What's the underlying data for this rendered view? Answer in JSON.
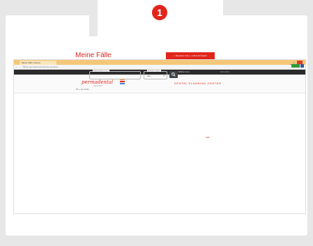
{
  "step_badge": "1",
  "browser": {
    "tab_title": "Meine Fälle | Perma",
    "address": "smile.permadental-planning.de/cases"
  },
  "app_bar": {
    "user": "Willkommen,",
    "logout": "Abmelden"
  },
  "header": {
    "logo": "permadental",
    "logo_sub": "Zahnersatz",
    "center_title": "DENTAL PLANNING CENTER"
  },
  "main": {
    "title": "Meine Fälle",
    "new_case_button": "+ NEUEN FALL HINZUFÜGEN",
    "patient_field": {
      "label": "Patient/Fallnummer",
      "value": ""
    },
    "status_field": {
      "label": "Aktueller Status",
      "value": "Alle"
    },
    "results_text": "20 + pro Seite",
    "footer_link": "Hilfe"
  },
  "colors": {
    "brand": "#e1251b",
    "dark_bar": "#2b2b2b",
    "tab_bar": "#f4c77a"
  }
}
